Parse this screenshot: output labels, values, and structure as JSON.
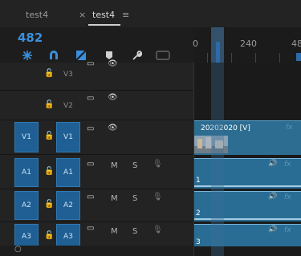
{
  "tabs": [
    {
      "label": "test4"
    },
    {
      "close": "×",
      "label": "test4",
      "menu": "≡"
    }
  ],
  "timecode": "482",
  "ruler": {
    "labels": [
      "0",
      "240",
      "48"
    ]
  },
  "tracks": {
    "video": [
      {
        "name": "V3"
      },
      {
        "name": "V2"
      },
      {
        "patch": "V1",
        "name": "V1"
      }
    ],
    "audio": [
      {
        "patch": "A1",
        "name": "A1",
        "m": "M",
        "s": "S"
      },
      {
        "patch": "A2",
        "name": "A2",
        "m": "M",
        "s": "S"
      },
      {
        "patch": "A3",
        "name": "A3",
        "m": "M",
        "s": "S"
      }
    ]
  },
  "clips": {
    "video": {
      "title": "20202020 [V]",
      "fx": "fx"
    },
    "audio": [
      {
        "number": "1",
        "fx": "fx"
      },
      {
        "number": "2",
        "fx": "fx"
      },
      {
        "number": "3",
        "fx": "fx"
      }
    ]
  },
  "colors": {
    "accent": "#3a8fdc",
    "patch": "#1f5f93",
    "clip": "#2c6d91"
  }
}
